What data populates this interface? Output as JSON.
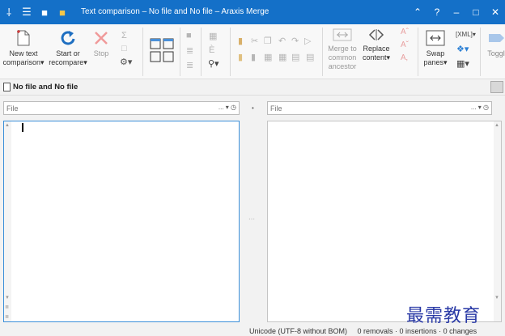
{
  "titlebar": {
    "title": "Text comparison – No file and No file – Araxis Merge"
  },
  "ribbon": {
    "new_text": "New text",
    "comparison": "comparison",
    "start_or": "Start or",
    "recompare": "recompare",
    "stop": "Stop",
    "merge_to": "Merge to",
    "common": "common",
    "ancestor": "ancestor",
    "replace": "Replace",
    "content": "content",
    "swap": "Swap",
    "panes": "panes",
    "toggle": "Toggl"
  },
  "document": {
    "title": "No file and No file"
  },
  "left_file": {
    "placeholder": "File"
  },
  "right_file": {
    "placeholder": "File"
  },
  "file_controls": "... ▾ ◷",
  "status": {
    "text": "Unicode (UTF-8 without BOM)     0 removals · 0 insertions · 0 changes"
  },
  "watermark": "最需教育",
  "colors": {
    "titlebar": "#1470c8",
    "active_pane_border": "#3b8fd9",
    "recompare_icon": "#1f6fc1",
    "stop_icon": "#e05050"
  }
}
